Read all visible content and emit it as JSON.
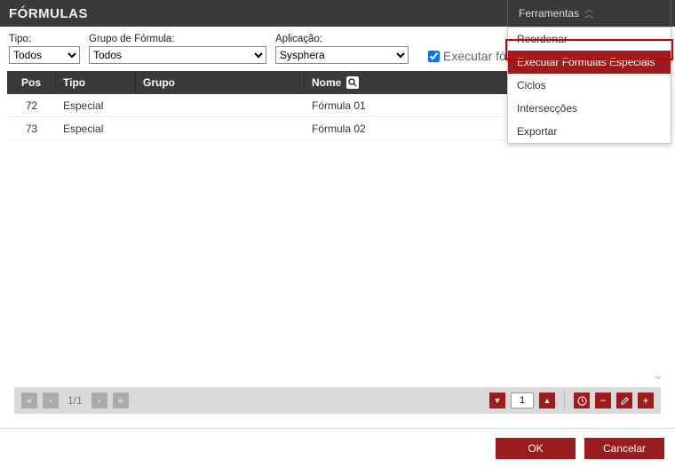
{
  "page": {
    "title": "FÓRMULAS"
  },
  "tools": {
    "tab_label": "Ferramentas",
    "items": [
      "Reordenar",
      "Executar Fórmulas Especiais",
      "Ciclos",
      "Intersecções",
      "Exportar"
    ],
    "highlighted": "Executar Fórmulas Especiais"
  },
  "filters": {
    "tipo": {
      "label": "Tipo:",
      "value": "Todos"
    },
    "grupo": {
      "label": "Grupo de Fórmula:",
      "value": "Todos"
    },
    "app": {
      "label": "Aplicação:",
      "value": "Sysphera"
    },
    "run_label": "Executar fórmulas nesta ordem",
    "run_checked": true
  },
  "grid": {
    "headers": {
      "pos": "Pos",
      "tipo": "Tipo",
      "grupo": "Grupo",
      "nome": "Nome"
    },
    "rows": [
      {
        "pos": "72",
        "tipo": "Especial",
        "grupo": "",
        "nome": "Fórmula 01"
      },
      {
        "pos": "73",
        "tipo": "Especial",
        "grupo": "",
        "nome": "Fórmula 02"
      }
    ]
  },
  "pager": {
    "text": "1/1",
    "page_value": "1"
  },
  "footer": {
    "ok": "OK",
    "cancel": "Cancelar"
  }
}
